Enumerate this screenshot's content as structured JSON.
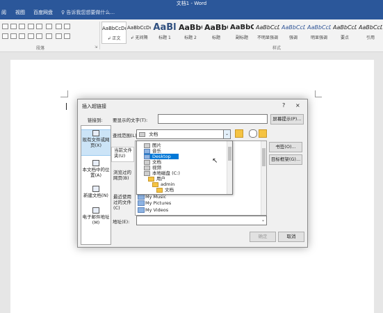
{
  "window": {
    "title": "文档1 - Word"
  },
  "menu": {
    "items": [
      "视图",
      "百度网盘"
    ],
    "tell_me": "告诉我您想要做什么..."
  },
  "ribbon": {
    "styles": [
      {
        "preview": "AaBbCcDd",
        "name": "↲ 正文"
      },
      {
        "preview": "AaBbCcDd",
        "name": "↲ 无间隔"
      },
      {
        "preview": "AaBl",
        "name": "标题 1"
      },
      {
        "preview": "AaBbC",
        "name": "标题 2"
      },
      {
        "preview": "AaBbC",
        "name": "标题"
      },
      {
        "preview": "AaBbC",
        "name": "副标题"
      },
      {
        "preview": "AaBbCcD",
        "name": "不明显强调"
      },
      {
        "preview": "AaBbCcD",
        "name": "强调"
      },
      {
        "preview": "AaBbCcD",
        "name": "明显强调"
      },
      {
        "preview": "AaBbCcD",
        "name": "要点"
      },
      {
        "preview": "AaBbCcD",
        "name": "引用"
      }
    ],
    "group_paragraph": "段落",
    "group_styles": "样式"
  },
  "dialog": {
    "title": "插入超链接",
    "help": "?",
    "close": "×",
    "link_to_label": "链接到:",
    "display_text_label": "要显示的文字(T):",
    "display_text_value": "",
    "screentip_button": "屏幕提示(P)...",
    "look_in_label": "查找范围(L):",
    "look_in_value": "文档",
    "link_types": [
      "现有文件或网页(X)",
      "本文档中的位置(A)",
      "新建文档(N)",
      "电子邮件地址(M)"
    ],
    "subnav": [
      "当前文件夹(U)",
      "浏览过的网页(B)",
      "最近使用过的文件(C)"
    ],
    "bookmark_button": "书签(O)...",
    "target_frame_button": "目标框架(G)...",
    "address_label": "地址(E):",
    "address_value": "",
    "ok_button": "确定",
    "cancel_button": "取消",
    "files": [
      "My Music",
      "My Pictures",
      "My Videos"
    ],
    "dropdown_items": [
      {
        "label": "图片",
        "indent": 1,
        "icon": "gray"
      },
      {
        "label": "音乐",
        "indent": 1,
        "icon": "blue"
      },
      {
        "label": "Desktop",
        "indent": 1,
        "icon": "blue",
        "highlighted": true
      },
      {
        "label": "文档",
        "indent": 1,
        "icon": "gray"
      },
      {
        "label": "视频",
        "indent": 1,
        "icon": "gray"
      },
      {
        "label": "本地磁盘 (C:)",
        "indent": 1,
        "icon": "gray"
      },
      {
        "label": "用户",
        "indent": 2,
        "icon": "folder"
      },
      {
        "label": "admin",
        "indent": 3,
        "icon": "folder"
      },
      {
        "label": "文档",
        "indent": 4,
        "icon": "folder"
      }
    ]
  }
}
